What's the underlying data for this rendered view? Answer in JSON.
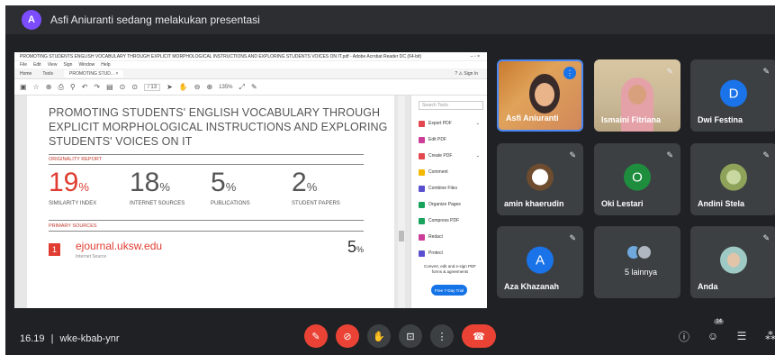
{
  "banner": {
    "avatar_letter": "A",
    "text": "Asfi Aniuranti sedang melakukan presentasi"
  },
  "presentation": {
    "window_title": "PROMOTING STUDENTS ENGLISH VOCABULARY THROUGH EXPLICIT MORPHOLOGICAL INSTRUCTIONS AND EXPLORING STUDENTS VOICES ON IT.pdf - Adobe Acrobat Reader DC (64-bit)",
    "window_controls": "–   ▫   ×",
    "menu": [
      "File",
      "Edit",
      "View",
      "Sign",
      "Window",
      "Help"
    ],
    "tabs": [
      "Home",
      "Tools",
      "PROMOTING STUD... ×"
    ],
    "tabs_right": "?   ⚠   Sign In",
    "page_indicator": "/ 13",
    "zoom": "135%",
    "doc_title": "PROMOTING STUDENTS' ENGLISH VOCABULARY THROUGH EXPLICIT MORPHOLOGICAL INSTRUCTIONS AND EXPLORING STUDENTS' VOICES ON IT",
    "originality_label": "ORIGINALITY REPORT",
    "stats": [
      {
        "value": "19",
        "unit": "%",
        "label": "SIMILARITY INDEX"
      },
      {
        "value": "18",
        "unit": "%",
        "label": "INTERNET SOURCES"
      },
      {
        "value": "5",
        "unit": "%",
        "label": "PUBLICATIONS"
      },
      {
        "value": "2",
        "unit": "%",
        "label": "STUDENT PAPERS"
      }
    ],
    "primary_label": "PRIMARY SOURCES",
    "source": {
      "rank": "1",
      "name": "ejournal.uksw.edu",
      "sub": "Internet Source",
      "pct": "5",
      "unit": "%"
    },
    "side_search": "Search Tools",
    "side_tools": [
      {
        "label": "Export PDF",
        "color": "#e34850"
      },
      {
        "label": "Edit PDF",
        "color": "#cc3d97"
      },
      {
        "label": "Create PDF",
        "color": "#e34850"
      },
      {
        "label": "Comment",
        "color": "#f5b800"
      },
      {
        "label": "Combine Files",
        "color": "#5a4fcf"
      },
      {
        "label": "Organize Pages",
        "color": "#1aa35d"
      },
      {
        "label": "Compress PDF",
        "color": "#1aa35d"
      },
      {
        "label": "Redact",
        "color": "#cc3d97"
      },
      {
        "label": "Protect",
        "color": "#5a4fcf"
      }
    ],
    "side_promo": "Convert, edit and e-sign PDF forms & agreements",
    "side_trial": "Free 7-Day Trial"
  },
  "participants": [
    {
      "name": "Asfi Aniuranti",
      "type": "video",
      "speaking": true
    },
    {
      "name": "Ismaini Fitriana",
      "type": "video",
      "muted": true
    },
    {
      "name": "Dwi Festina",
      "type": "avatar",
      "letter": "D",
      "color": "#1a73e8",
      "muted": true
    },
    {
      "name": "amin khaerudin",
      "type": "photo",
      "muted": true
    },
    {
      "name": "Oki Lestari",
      "type": "avatar",
      "letter": "O",
      "color": "#1e8e3e",
      "muted": true
    },
    {
      "name": "Andini Stela",
      "type": "photo",
      "muted": true
    },
    {
      "name": "Aza Khazanah",
      "type": "avatar",
      "letter": "A",
      "color": "#1a73e8",
      "muted": true
    },
    {
      "name": "5 lainnya",
      "type": "group"
    },
    {
      "name": "Anda",
      "type": "photo",
      "muted": true
    }
  ],
  "bottom": {
    "time": "16.19",
    "separator": "|",
    "meeting_code": "wke-kbab-ynr",
    "participant_count": "14",
    "controls": [
      {
        "icon": "mic-off-icon",
        "glyph": "✎"
      },
      {
        "icon": "camera-off-icon",
        "glyph": "⊘"
      },
      {
        "icon": "raise-hand-icon",
        "glyph": "✋"
      },
      {
        "icon": "present-icon",
        "glyph": "⊡"
      },
      {
        "icon": "more-icon",
        "glyph": "⋮"
      },
      {
        "icon": "end-call-icon",
        "glyph": "☎"
      }
    ]
  }
}
